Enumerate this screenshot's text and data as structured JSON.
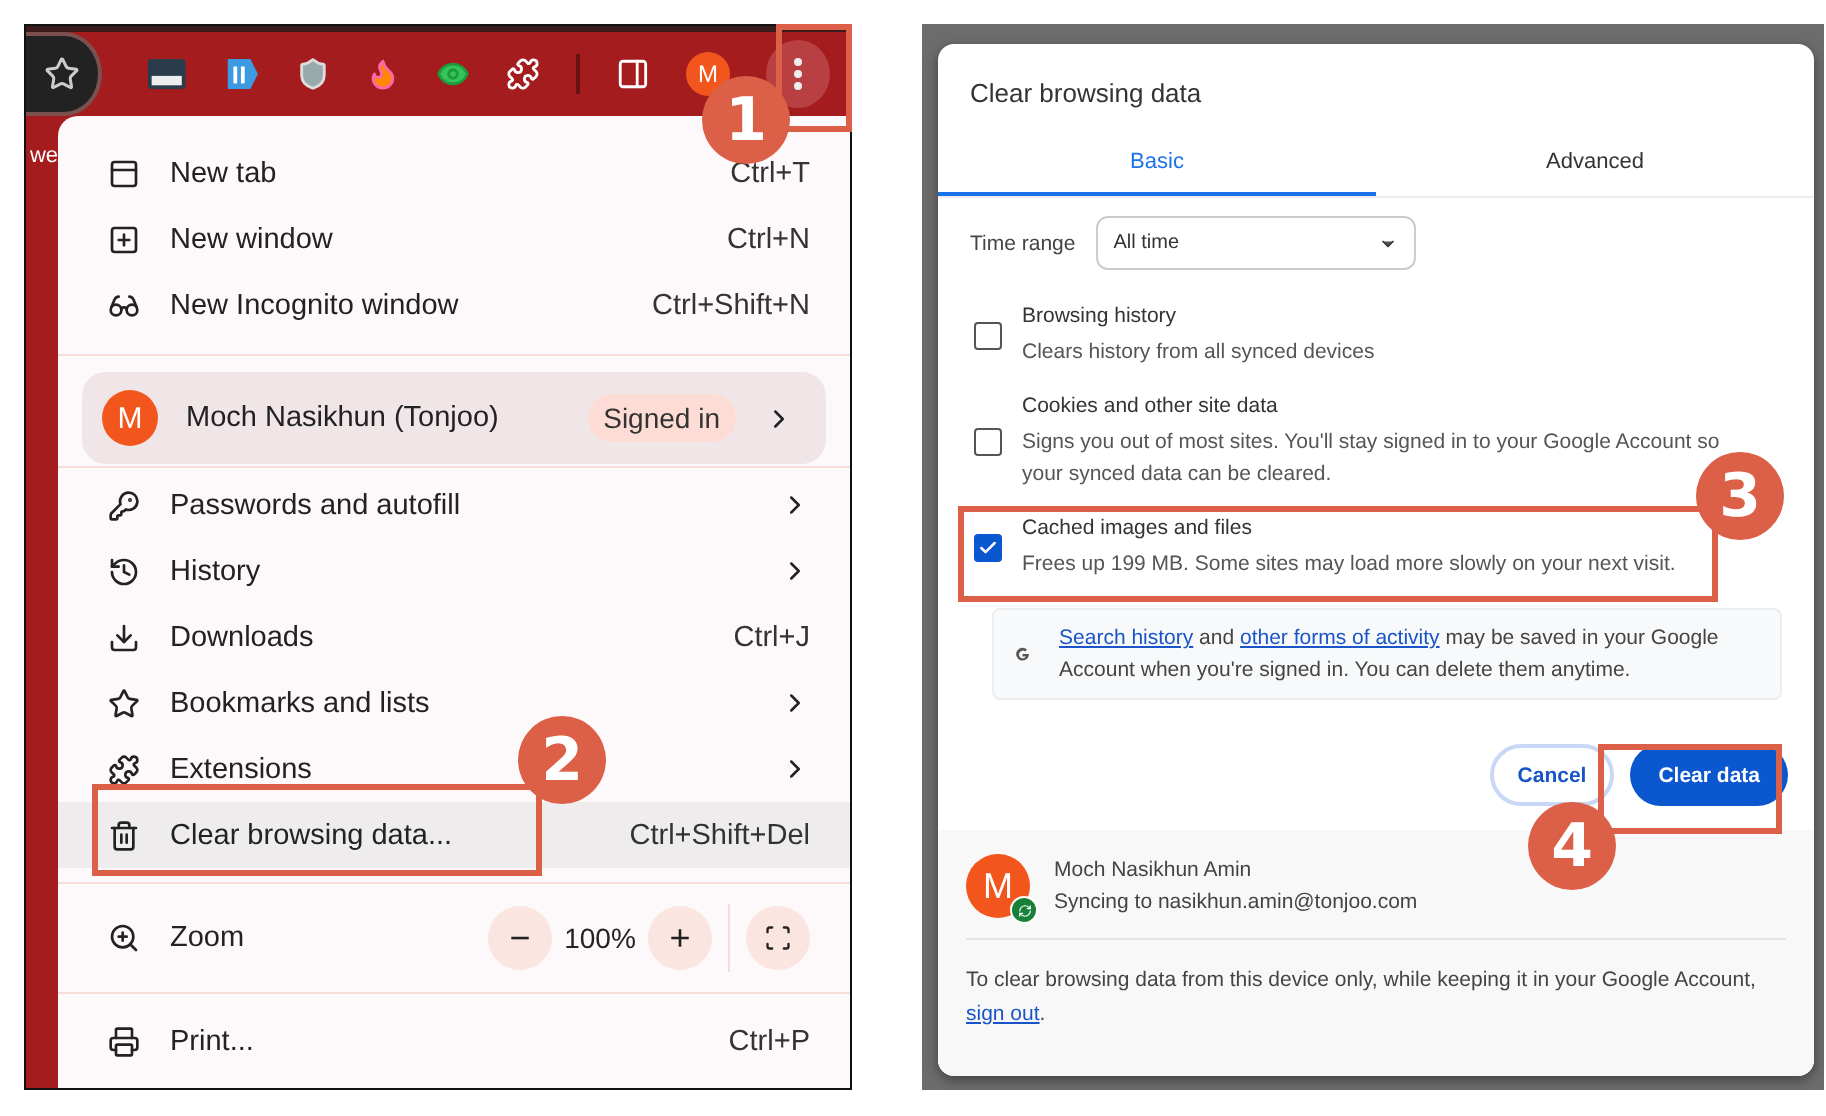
{
  "browser": {
    "page_text": "we",
    "avatar_letter": "M"
  },
  "menu": {
    "sections": [
      {
        "kind": "items",
        "items": [
          {
            "label": "New tab",
            "shortcut": "Ctrl+T",
            "submenu": false,
            "highlighted": false
          },
          {
            "label": "New window",
            "shortcut": "Ctrl+N",
            "submenu": false,
            "highlighted": false
          },
          {
            "label": "New Incognito window",
            "shortcut": "Ctrl+Shift+N",
            "submenu": false,
            "highlighted": false
          }
        ]
      },
      {
        "kind": "profile",
        "avatar": "M",
        "name": "Moch Nasikhun (Tonjoo)",
        "badge": "Signed in"
      },
      {
        "kind": "items",
        "items": [
          {
            "label": "Passwords and autofill",
            "submenu": true,
            "highlighted": false
          },
          {
            "label": "History",
            "submenu": true,
            "highlighted": false
          },
          {
            "label": "Downloads",
            "shortcut": "Ctrl+J",
            "submenu": false,
            "highlighted": false
          },
          {
            "label": "Bookmarks and lists",
            "submenu": true,
            "highlighted": false
          },
          {
            "label": "Extensions",
            "submenu": true,
            "highlighted": false
          },
          {
            "label": "Clear browsing data...",
            "shortcut": "Ctrl+Shift+Del",
            "submenu": false,
            "highlighted": true
          }
        ]
      },
      {
        "kind": "zoom",
        "label": "Zoom",
        "minus": "−",
        "value": "100%",
        "plus": "+"
      },
      {
        "kind": "items",
        "items": [
          {
            "label": "Print...",
            "shortcut": "Ctrl+P",
            "submenu": false,
            "highlighted": false
          }
        ]
      }
    ]
  },
  "dialog": {
    "title": "Clear browsing data",
    "tabs": [
      {
        "label": "Basic",
        "selected": true
      },
      {
        "label": "Advanced",
        "selected": false
      }
    ],
    "time_range": {
      "label": "Time range",
      "value": "All time"
    },
    "options": [
      {
        "title": "Browsing history",
        "description": "Clears history from all synced devices",
        "checked": false
      },
      {
        "title": "Cookies and other site data",
        "description": "Signs you out of most sites. You'll stay signed in to your Google Account so your synced data can be cleared.",
        "checked": false
      },
      {
        "title": "Cached images and files",
        "description": "Frees up 199 MB. Some sites may load more slowly on your next visit.",
        "checked": true
      }
    ],
    "info": {
      "parts": [
        {
          "text": "Search history",
          "link": true
        },
        {
          "text": " and ",
          "link": false
        },
        {
          "text": "other forms of activity",
          "link": true
        },
        {
          "text": " may be saved in your Google Account when you're signed in. You can delete them anytime.",
          "link": false
        }
      ]
    },
    "buttons": {
      "cancel": "Cancel",
      "confirm": "Clear data"
    },
    "account": {
      "avatar": "M",
      "name": "Moch Nasikhun Amin",
      "sync": "Syncing to nasikhun.amin@tonjoo.com"
    },
    "footer": {
      "parts": [
        {
          "text": "To clear browsing data from this device only, while keeping it in your Google Account, ",
          "link": false
        },
        {
          "text": "sign out",
          "link": true
        },
        {
          "text": ".",
          "link": false
        }
      ]
    }
  },
  "steps": [
    "1",
    "2",
    "3",
    "4"
  ]
}
